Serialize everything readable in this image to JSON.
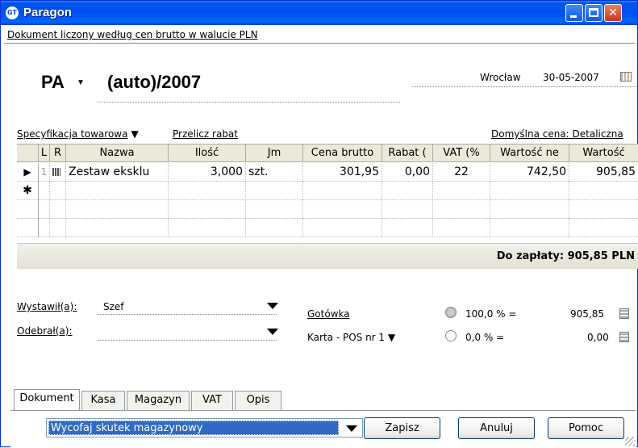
{
  "window": {
    "title": "Paragon",
    "app_icon": "GT"
  },
  "info_bar": "Dokument liczony według cen brutto w walucie PLN",
  "document": {
    "prefix": "PA",
    "number": "(auto)/2007",
    "place": "Wrocław",
    "date": "30-05-2007"
  },
  "links": {
    "spec": "Specyfikacja towarowa",
    "recalc": "Przelicz rabat",
    "default_price": "Domyślna cena: Detaliczna"
  },
  "grid": {
    "columns": [
      "L",
      "R",
      "Nazwa",
      "Ilość",
      "Jm",
      "Cena brutto",
      "Rabat (",
      "VAT (%",
      "Wartość ne",
      "Wartość"
    ],
    "rows": [
      {
        "lp": "1",
        "name": "Zestaw eksklu",
        "qty": "3,000",
        "unit": "szt.",
        "price": "301,95",
        "discount": "0,00",
        "vat": "22",
        "net": "742,50",
        "gross": "905,85"
      }
    ],
    "new_row_marker": "✱",
    "current_row_marker": "▶"
  },
  "total": "Do zapłaty: 905,85 PLN",
  "issued_by": {
    "label": "Wystawił(a):",
    "value": "Szef"
  },
  "received_by": {
    "label": "Odebrał(a):",
    "value": ""
  },
  "payments": [
    {
      "label": "Gotówka",
      "percent": "100,0 % =",
      "amount": "905,85"
    },
    {
      "label": "Karta - POS nr 1",
      "percent": "0,0 % =",
      "amount": "0,00"
    }
  ],
  "tabs": [
    "Dokument",
    "Kasa",
    "Magazyn",
    "VAT",
    "Opis"
  ],
  "action_combo": "Wycofaj skutek magazynowy",
  "buttons": {
    "save": "Zapisz",
    "cancel": "Anuluj",
    "help": "Pomoc"
  },
  "colors": {
    "title_blue": "#0050ee",
    "selection": "#316ac5"
  }
}
